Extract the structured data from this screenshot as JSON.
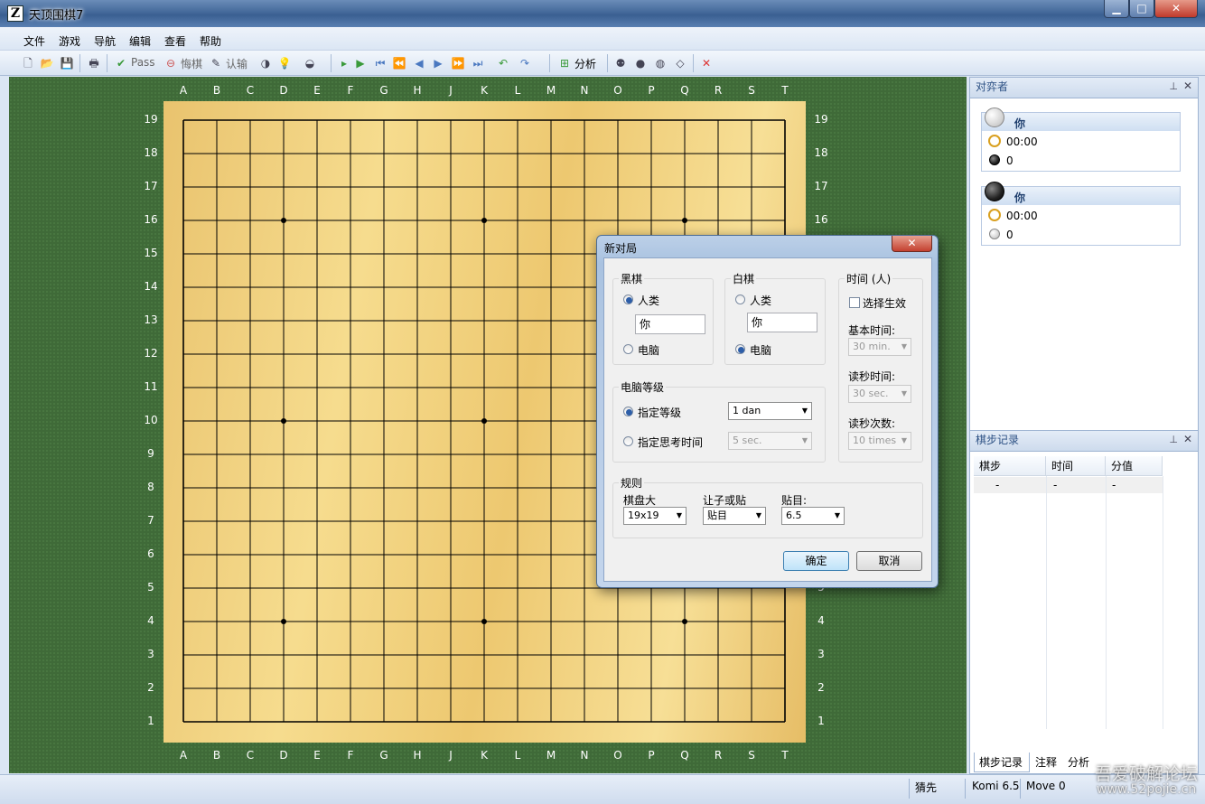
{
  "window": {
    "title": "天顶围棋7",
    "min": "▁",
    "max": "□",
    "close": "✕"
  },
  "menu": [
    "文件",
    "游戏",
    "导航",
    "编辑",
    "查看",
    "帮助"
  ],
  "toolbar": {
    "pass": "Pass",
    "undo": "悔棋",
    "resign": "认输",
    "analysis": "分析"
  },
  "board": {
    "size": 19,
    "columns": [
      "A",
      "B",
      "C",
      "D",
      "E",
      "F",
      "G",
      "H",
      "J",
      "K",
      "L",
      "M",
      "N",
      "O",
      "P",
      "Q",
      "R",
      "S",
      "T"
    ],
    "rows": [
      "19",
      "18",
      "17",
      "16",
      "15",
      "14",
      "13",
      "12",
      "11",
      "10",
      "9",
      "8",
      "7",
      "6",
      "5",
      "4",
      "3",
      "2",
      "1"
    ]
  },
  "players_panel": {
    "title": "对弈者",
    "players": [
      {
        "name": "你",
        "stone": "white",
        "time": "00:00",
        "captures": "0",
        "capture_stone": "black"
      },
      {
        "name": "你",
        "stone": "black",
        "time": "00:00",
        "captures": "0",
        "capture_stone": "white"
      }
    ]
  },
  "moves_panel": {
    "title": "棋步记录",
    "columns": [
      "棋步",
      "时间",
      "分值"
    ],
    "rows": [
      [
        "-",
        "-",
        "-"
      ]
    ],
    "tabs": [
      "棋步记录",
      "注释",
      "分析"
    ]
  },
  "status": {
    "mode": "猜先",
    "komi": "Komi 6.5",
    "move": "Move 0"
  },
  "watermark": {
    "line1": "吾爱破解论坛",
    "line2": "www.52pojie.cn"
  },
  "dialog": {
    "title": "新对局",
    "close": "✕",
    "black": {
      "label": "黑棋",
      "human": "人类",
      "name": "你",
      "computer": "电脑",
      "selected": "human"
    },
    "white": {
      "label": "白棋",
      "human": "人类",
      "name": "你",
      "computer": "电脑",
      "selected": "computer"
    },
    "time": {
      "label": "时间 (人)",
      "enable": "选择生效",
      "base_label": "基本时间:",
      "base_value": "30 min.",
      "byoyomi_label": "读秒时间:",
      "byoyomi_value": "30 sec.",
      "periods_label": "读秒次数:",
      "periods_value": "10 times"
    },
    "level": {
      "label": "电脑等级",
      "fixed": "指定等级",
      "fixed_value": "1 dan",
      "think": "指定思考时间",
      "think_value": "5 sec."
    },
    "rules": {
      "label": "规则",
      "size_label": "棋盘大",
      "size_value": "19x19",
      "handicap_label": "让子或贴",
      "handicap_value": "贴目",
      "komi_label": "贴目:",
      "komi_value": "6.5"
    },
    "ok": "确定",
    "cancel": "取消"
  }
}
